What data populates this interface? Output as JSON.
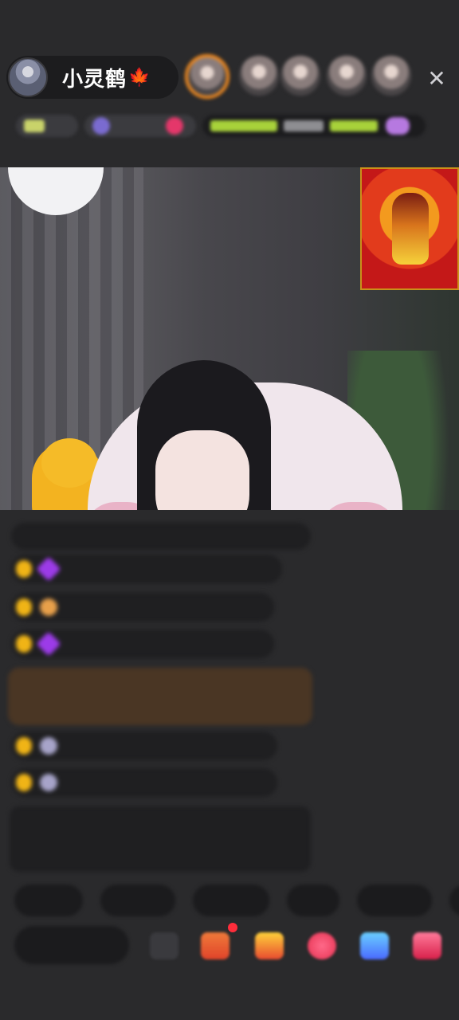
{
  "header": {
    "host_name": "小灵鹤",
    "host_emoji": "🍁",
    "close_glyph": "✕",
    "viewers": [
      "viewer-1",
      "viewer-2",
      "viewer-3",
      "viewer-4",
      "viewer-5"
    ]
  },
  "tag_row": {
    "tags": [
      "",
      "",
      "",
      "",
      ""
    ]
  },
  "chat": {
    "first_line": "",
    "messages": [
      {
        "badge": "",
        "nick": "",
        "text": ""
      },
      {
        "badge": "",
        "nick": "",
        "text": ""
      },
      {
        "badge": "",
        "nick": "",
        "text": ""
      },
      {
        "badge": "",
        "nick": "",
        "text": ""
      },
      {
        "badge": "",
        "nick": "",
        "text": ""
      }
    ],
    "special_text": "",
    "notice_text": ""
  },
  "quick_replies": [
    "",
    "",
    "",
    "",
    ""
  ],
  "toolbar": {
    "input_placeholder": "",
    "icons": [
      "keyboard-icon",
      "gift-box-icon",
      "fries-icon",
      "lips-icon",
      "gamepad-icon",
      "red-packet-icon"
    ]
  },
  "colors": {
    "accent": "#f28a1e",
    "badge": "#f0b416",
    "background": "#2a2a2c",
    "notice_green": "#7ed26a"
  }
}
